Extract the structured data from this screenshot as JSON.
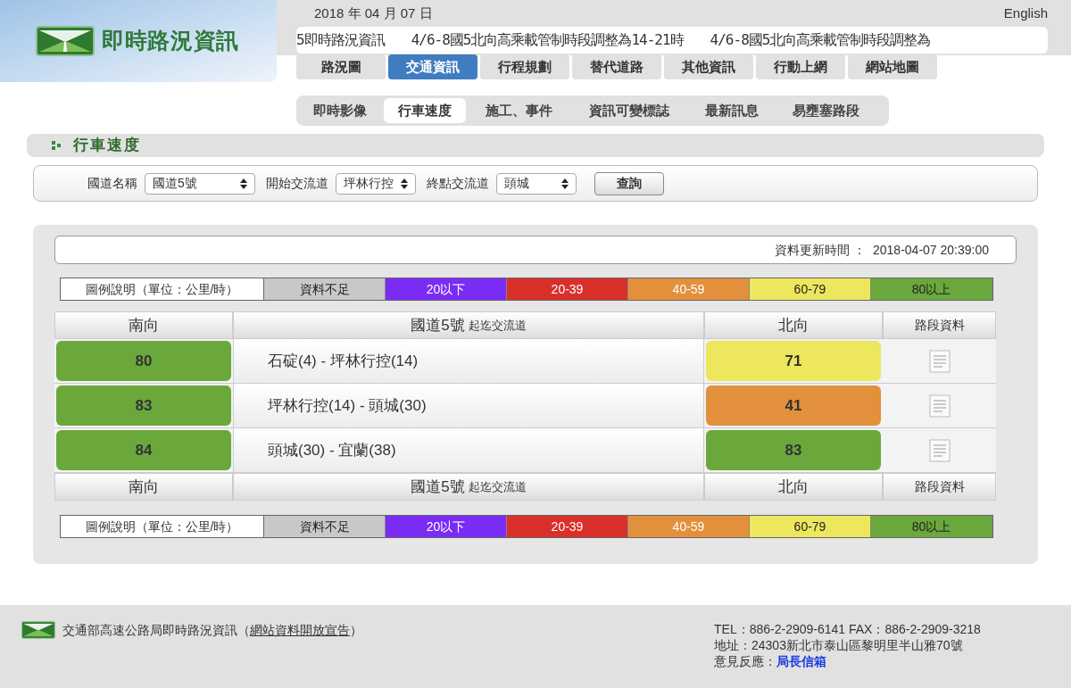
{
  "header": {
    "date": "2018 年 04 月 07 日",
    "language_link": "English",
    "site_title": "即時路況資訊",
    "ticker": "5即時路況資訊　　4/6-8國5北向高乘載管制時段調整為14-21時　　4/6-8國5北向高乘載管制時段調整為"
  },
  "tabs": [
    {
      "label": "路況圖",
      "selected": false
    },
    {
      "label": "交通資訊",
      "selected": true
    },
    {
      "label": "行程規劃",
      "selected": false
    },
    {
      "label": "替代道路",
      "selected": false
    },
    {
      "label": "其他資訊",
      "selected": false
    },
    {
      "label": "行動上網",
      "selected": false
    },
    {
      "label": "網站地圖",
      "selected": false
    }
  ],
  "subtabs": [
    {
      "label": "即時影像",
      "selected": false
    },
    {
      "label": "行車速度",
      "selected": true
    },
    {
      "label": "施工、事件",
      "selected": false
    },
    {
      "label": "資訊可變標誌",
      "selected": false
    },
    {
      "label": "最新訊息",
      "selected": false
    },
    {
      "label": "易壅塞路段",
      "selected": false
    }
  ],
  "section_title": "行車速度",
  "filters": [
    {
      "label": "國道名稱",
      "value": "國道5號"
    },
    {
      "label": "開始交流道",
      "value": "坪林行控"
    },
    {
      "label": "終點交流道",
      "value": "頭城"
    }
  ],
  "query_button": "查詢",
  "update_time": {
    "label": "資料更新時間 ：",
    "value": "2018-04-07 20:39:00"
  },
  "legend_top": {
    "title": "圖例說明（單位：公里/時）",
    "items": [
      {
        "label": "資料不足",
        "color": "#c8c8c8"
      },
      {
        "label": "20以下",
        "color": "#7a2cf5"
      },
      {
        "label": "20-39",
        "color": "#d9302a"
      },
      {
        "label": "40-59",
        "color": "#e3903c"
      },
      {
        "label": "60-79",
        "color": "#ece75c"
      },
      {
        "label": "80以上",
        "color": "#6aa83c"
      }
    ]
  },
  "table": {
    "columns": [
      {
        "label": "南向"
      },
      {
        "label": "國道5號",
        "sub": "起迄交流道"
      },
      {
        "label": "北向"
      },
      {
        "label": "路段資料"
      }
    ],
    "rows": [
      {
        "south": {
          "value": "80",
          "color": "#6aa83c"
        },
        "segment": "石碇(4) - 坪林行控(14)",
        "north": {
          "value": "71",
          "color": "#ece75c"
        }
      },
      {
        "south": {
          "value": "83",
          "color": "#6aa83c"
        },
        "segment": "坪林行控(14) - 頭城(30)",
        "north": {
          "value": "41",
          "color": "#e3903c"
        }
      },
      {
        "south": {
          "value": "84",
          "color": "#6aa83c"
        },
        "segment": "頭城(30) - 宜蘭(38)",
        "north": {
          "value": "83",
          "color": "#6aa83c"
        }
      }
    ],
    "footer_columns": [
      {
        "label": "南向"
      },
      {
        "label": "國道5號",
        "sub": "起迄交流道"
      },
      {
        "label": "北向"
      },
      {
        "label": "路段資料"
      }
    ]
  },
  "legend_bottom": {
    "title": "圖例說明（單位：公里/時）",
    "items": [
      {
        "label": "資料不足",
        "color": "#c8c8c8"
      },
      {
        "label": "20以下",
        "color": "#7a2cf5"
      },
      {
        "label": "20-39",
        "color": "#d9302a"
      },
      {
        "label": "40-59",
        "color": "#e3903c"
      },
      {
        "label": "60-79",
        "color": "#ece75c"
      },
      {
        "label": "80以上",
        "color": "#6aa83c"
      }
    ]
  },
  "footer": {
    "org": "交通部高速公路局即時路況資訊（",
    "link": "網站資料開放宣告",
    "org_end": "）",
    "lines": [
      {
        "text": "TEL：886-2-2909-6141 FAX：886-2-2909-3218"
      },
      {
        "text": "地址：24303新北市泰山區黎明里半山雅70號"
      },
      {
        "text": "意見反應：",
        "link": "局長信箱"
      }
    ]
  }
}
